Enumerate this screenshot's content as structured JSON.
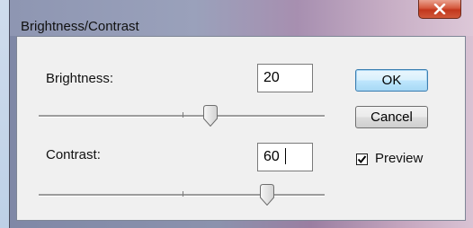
{
  "window": {
    "title": "Brightness/Contrast"
  },
  "brightness": {
    "label": "Brightness:",
    "value": "20"
  },
  "contrast": {
    "label": "Contrast:",
    "value": "60"
  },
  "buttons": {
    "ok": "OK",
    "cancel": "Cancel"
  },
  "preview": {
    "label": "Preview",
    "checked": true
  },
  "icons": {
    "close": "close-icon",
    "check": "checkmark-icon"
  },
  "colors": {
    "ok_border": "#3c7fb1",
    "close_button": "#c2371d"
  }
}
